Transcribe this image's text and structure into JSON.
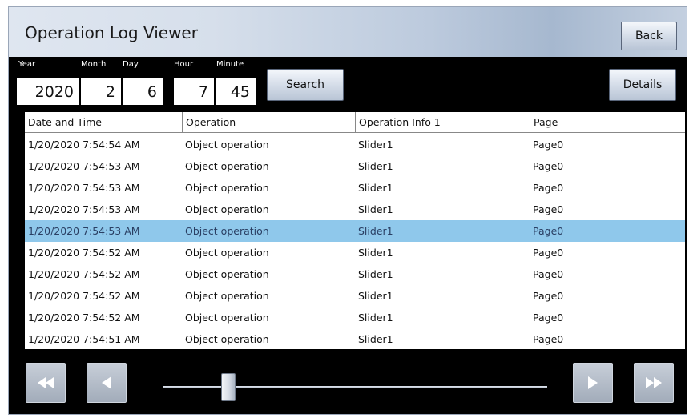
{
  "window": {
    "title": "Operation Log Viewer",
    "back_label": "Back",
    "search_label": "Search",
    "details_label": "Details"
  },
  "datetime": {
    "year_label": "Year",
    "year_value": "2020",
    "month_label": "Month",
    "month_value": "2",
    "day_label": "Day",
    "day_value": "6",
    "hour_label": "Hour",
    "hour_value": "7",
    "minute_label": "Minute",
    "minute_value": "45"
  },
  "table": {
    "columns": [
      "Date and Time",
      "Operation",
      "Operation Info 1",
      "Page"
    ],
    "selected_row_index": 4,
    "rows": [
      [
        "1/20/2020 7:54:54 AM",
        "Object operation",
        "Slider1",
        "Page0"
      ],
      [
        "1/20/2020 7:54:53 AM",
        "Object operation",
        "Slider1",
        "Page0"
      ],
      [
        "1/20/2020 7:54:53 AM",
        "Object operation",
        "Slider1",
        "Page0"
      ],
      [
        "1/20/2020 7:54:53 AM",
        "Object operation",
        "Slider1",
        "Page0"
      ],
      [
        "1/20/2020 7:54:53 AM",
        "Object operation",
        "Slider1",
        "Page0"
      ],
      [
        "1/20/2020 7:54:52 AM",
        "Object operation",
        "Slider1",
        "Page0"
      ],
      [
        "1/20/2020 7:54:52 AM",
        "Object operation",
        "Slider1",
        "Page0"
      ],
      [
        "1/20/2020 7:54:52 AM",
        "Object operation",
        "Slider1",
        "Page0"
      ],
      [
        "1/20/2020 7:54:52 AM",
        "Object operation",
        "Slider1",
        "Page0"
      ],
      [
        "1/20/2020 7:54:51 AM",
        "Object operation",
        "Slider1",
        "Page0"
      ]
    ]
  },
  "navigation": {
    "first_icon": "double-left-arrow-icon",
    "prev_icon": "left-arrow-icon",
    "next_icon": "right-arrow-icon",
    "last_icon": "double-right-arrow-icon",
    "scroll_position": 0.17
  },
  "colors": {
    "selected_row": "#8fc8eb",
    "background": "#000000",
    "title_bar": "#c9d4e2"
  }
}
